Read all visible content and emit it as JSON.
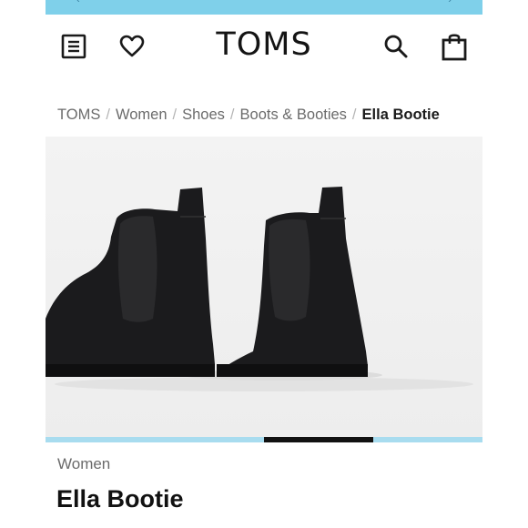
{
  "header": {
    "logo": "TOMS",
    "icons": [
      "menu-icon",
      "heart-icon",
      "search-icon",
      "bag-icon"
    ]
  },
  "breadcrumb": {
    "items": [
      "TOMS",
      "Women",
      "Shoes",
      "Boots & Booties"
    ],
    "current": "Ella Bootie",
    "separator": "/"
  },
  "gallery": {
    "active_index": 2,
    "total": 4,
    "image_alt": "Black suede chelsea bootie pair"
  },
  "product": {
    "category": "Women",
    "name": "Ella Bootie"
  },
  "colors": {
    "accent": "#7fd0ea",
    "progress_track": "#a8dcef",
    "progress_active": "#111111",
    "text_primary": "#111111",
    "text_muted": "#6b6b6b"
  }
}
